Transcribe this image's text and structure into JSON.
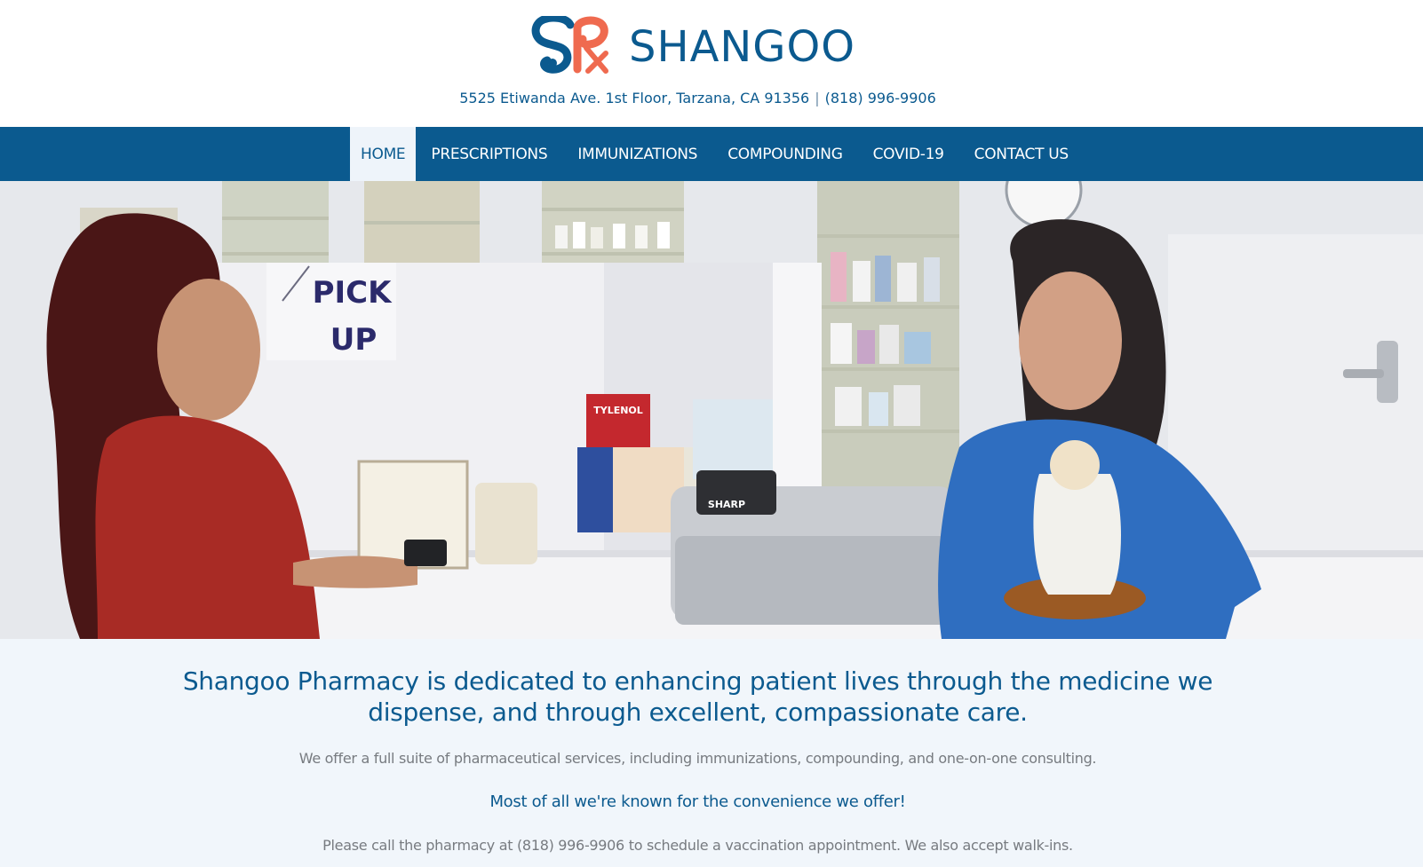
{
  "brand": {
    "name": "SHANGOO",
    "logo_icon": "shangoo-rx-logo",
    "colors": {
      "primary": "#0b5a8f",
      "accent": "#ef6a4f"
    }
  },
  "header": {
    "address": "5525 Etiwanda Ave. 1st Floor, Tarzana, CA 91356",
    "separator": "|",
    "phone": "(818) 996-9906"
  },
  "nav": {
    "items": [
      {
        "label": "HOME",
        "active": true
      },
      {
        "label": "PRESCRIPTIONS",
        "active": false
      },
      {
        "label": "IMMUNIZATIONS",
        "active": false
      },
      {
        "label": "COMPOUNDING",
        "active": false
      },
      {
        "label": "COVID-19",
        "active": false
      },
      {
        "label": "CONTACT US",
        "active": false
      }
    ]
  },
  "hero": {
    "sign_line1": "PICK",
    "sign_line2": "UP",
    "register_brand": "SHARP",
    "product_label": "TYLENOL"
  },
  "main": {
    "headline": "Shangoo Pharmacy is dedicated to enhancing patient lives through the medicine we dispense, and through excellent, compassionate care.",
    "services": "We offer a full suite of pharmaceutical services, including immunizations, compounding, and one-on-one consulting.",
    "tagline": "Most of all we're known for the convenience we offer!",
    "call_note": "Please call the pharmacy at (818) 996-9906 to schedule a vaccination appointment. We also accept walk-ins."
  }
}
